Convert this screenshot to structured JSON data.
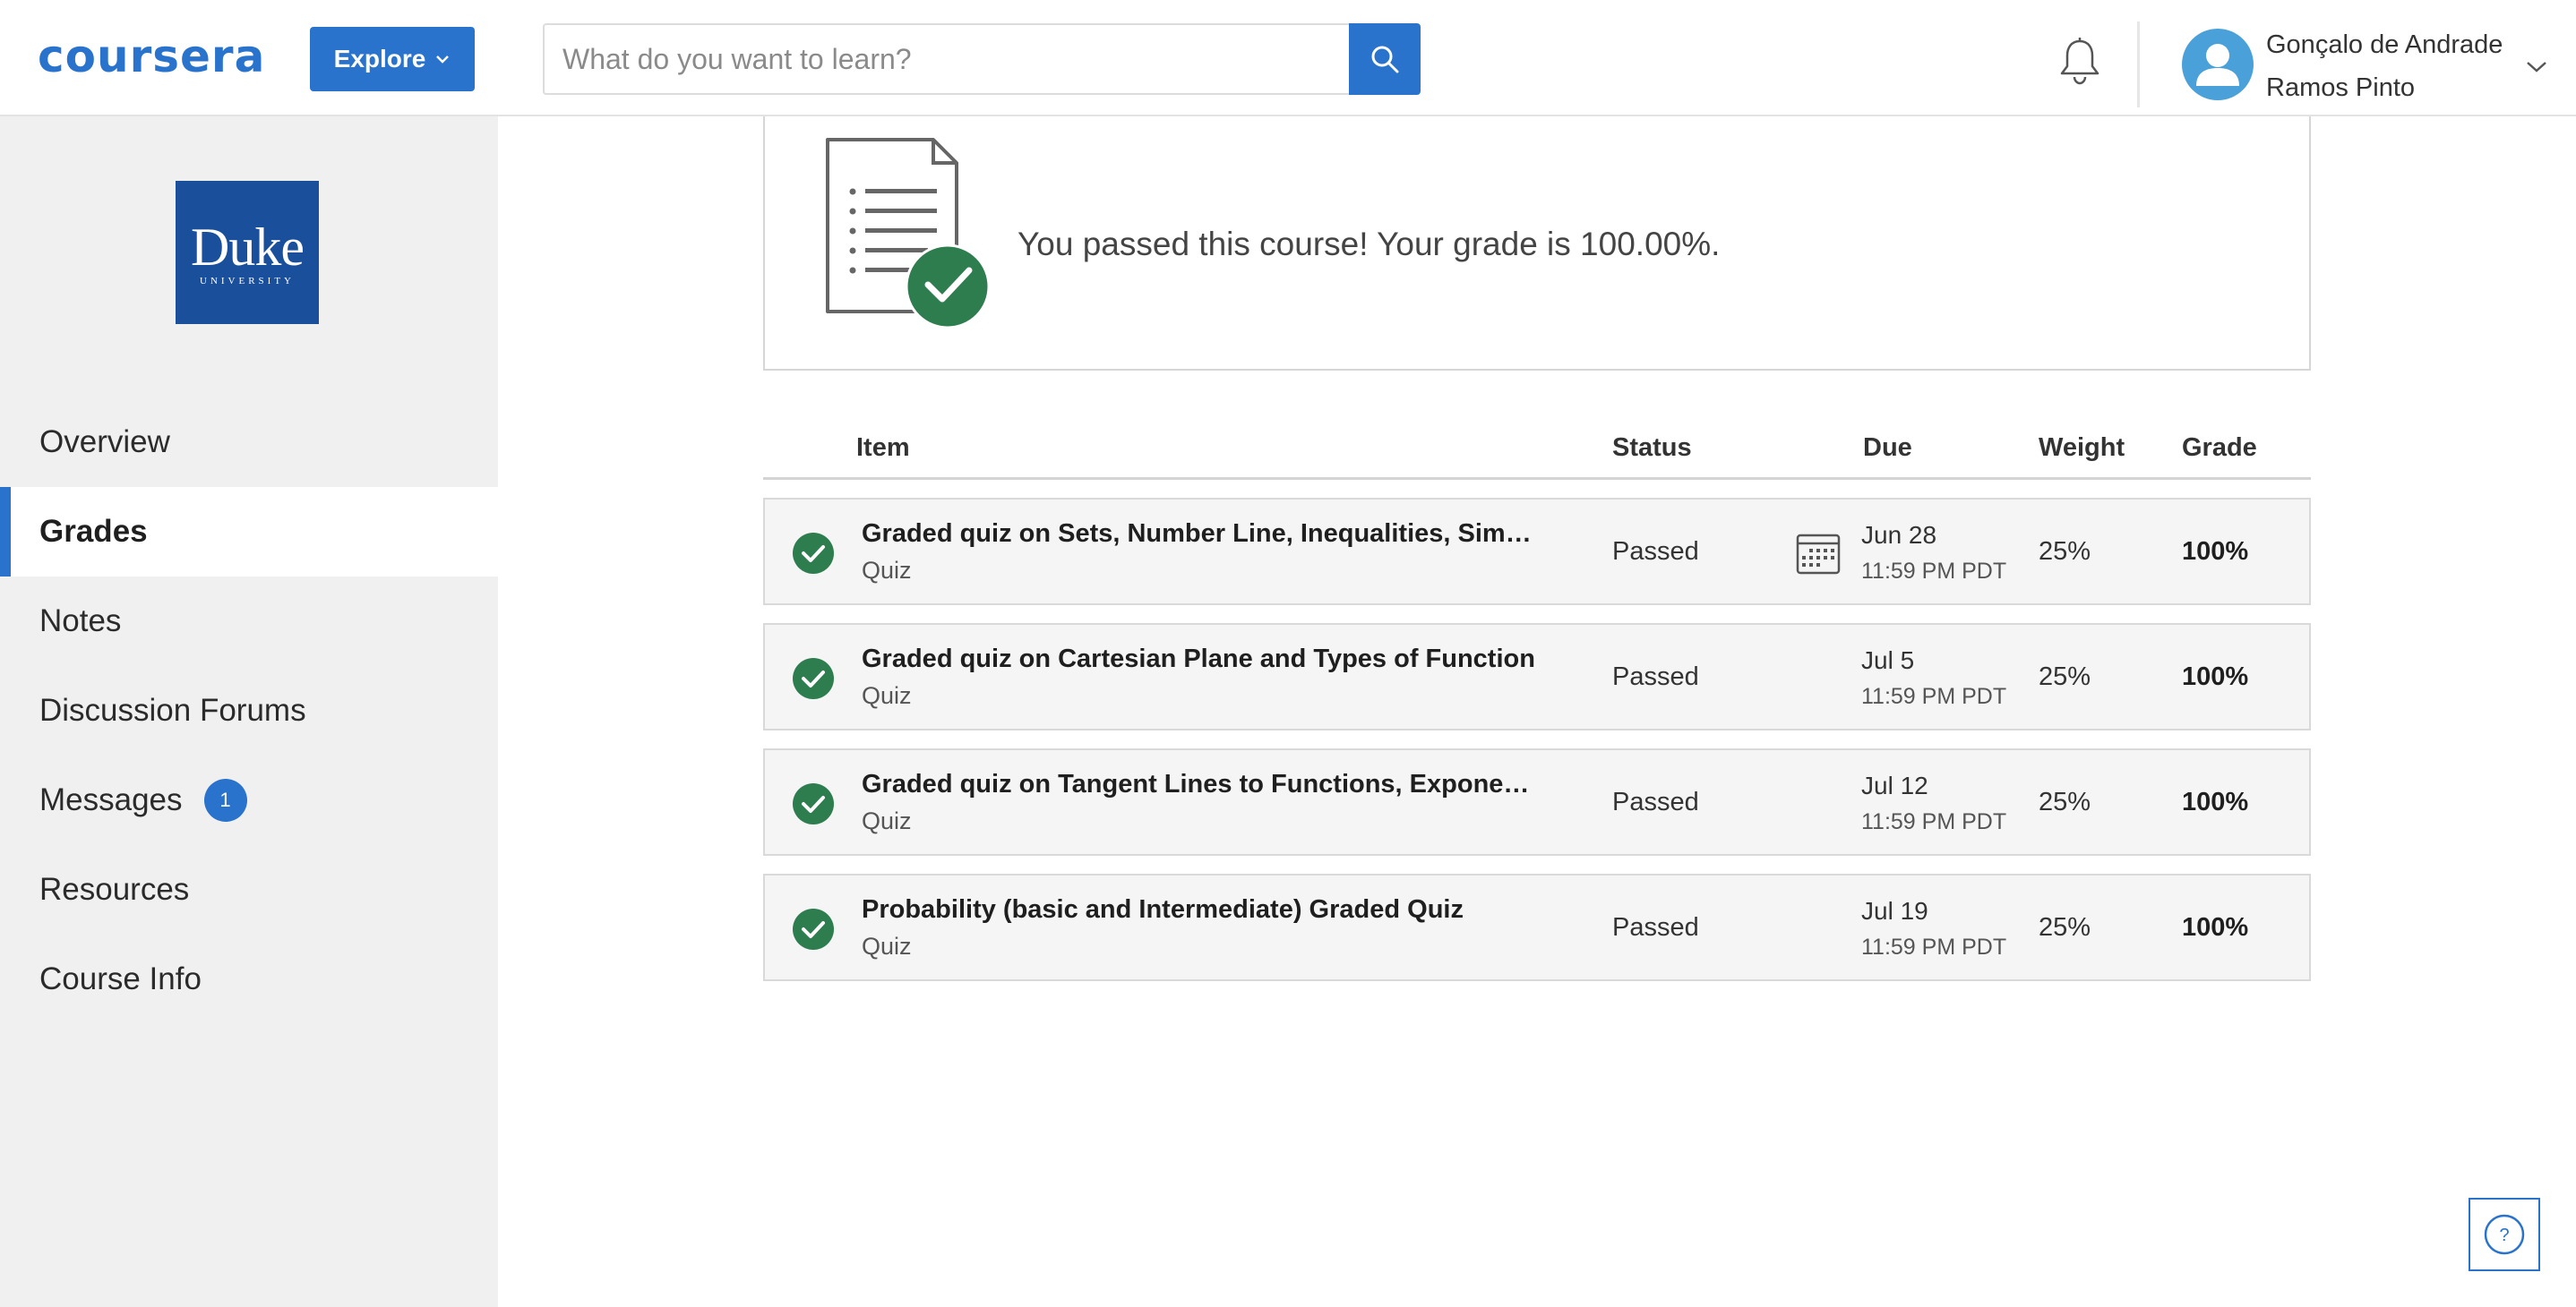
{
  "header": {
    "logo_text": "coursera",
    "explore_label": "Explore",
    "search_placeholder": "What do you want to learn?",
    "user_name_line1": "Gonçalo de Andrade",
    "user_name_line2": "Ramos Pinto"
  },
  "sidebar": {
    "logo_word": "Duke",
    "logo_subword": "UNIVERSITY",
    "items": [
      {
        "label": "Overview"
      },
      {
        "label": "Grades"
      },
      {
        "label": "Notes"
      },
      {
        "label": "Discussion Forums"
      },
      {
        "label": "Messages",
        "badge": "1"
      },
      {
        "label": "Resources"
      },
      {
        "label": "Course Info"
      }
    ]
  },
  "summary": {
    "message": "You passed this course! Your grade is 100.00%."
  },
  "table": {
    "headers": {
      "item": "Item",
      "status": "Status",
      "due": "Due",
      "weight": "Weight",
      "grade": "Grade"
    },
    "rows": [
      {
        "title": "Graded quiz on Sets, Number Line, Inequalities, Simplification, and Sigma Notation",
        "type": "Quiz",
        "status": "Passed",
        "due_date": "Jun 28",
        "due_time": "11:59 PM PDT",
        "weight": "25%",
        "grade": "100%"
      },
      {
        "title": "Graded quiz on Cartesian Plane and Types of Function",
        "type": "Quiz",
        "status": "Passed",
        "due_date": "Jul 5",
        "due_time": "11:59 PM PDT",
        "weight": "25%",
        "grade": "100%"
      },
      {
        "title": "Graded quiz on Tangent Lines to Functions, Exponents and Logarithms",
        "type": "Quiz",
        "status": "Passed",
        "due_date": "Jul 12",
        "due_time": "11:59 PM PDT",
        "weight": "25%",
        "grade": "100%"
      },
      {
        "title": "Probability (basic and Intermediate) Graded Quiz",
        "type": "Quiz",
        "status": "Passed",
        "due_date": "Jul 19",
        "due_time": "11:59 PM PDT",
        "weight": "25%",
        "grade": "100%"
      }
    ]
  },
  "help": {
    "label": "?"
  },
  "colors": {
    "brand": "#2a73cc",
    "success": "#2e7d4f",
    "duke": "#1a4f9c"
  },
  "icons": [
    "chevron-down-icon",
    "search-icon",
    "bell-icon",
    "user-icon",
    "document-check-icon",
    "check-circle-icon",
    "calendar-icon",
    "help-icon"
  ]
}
